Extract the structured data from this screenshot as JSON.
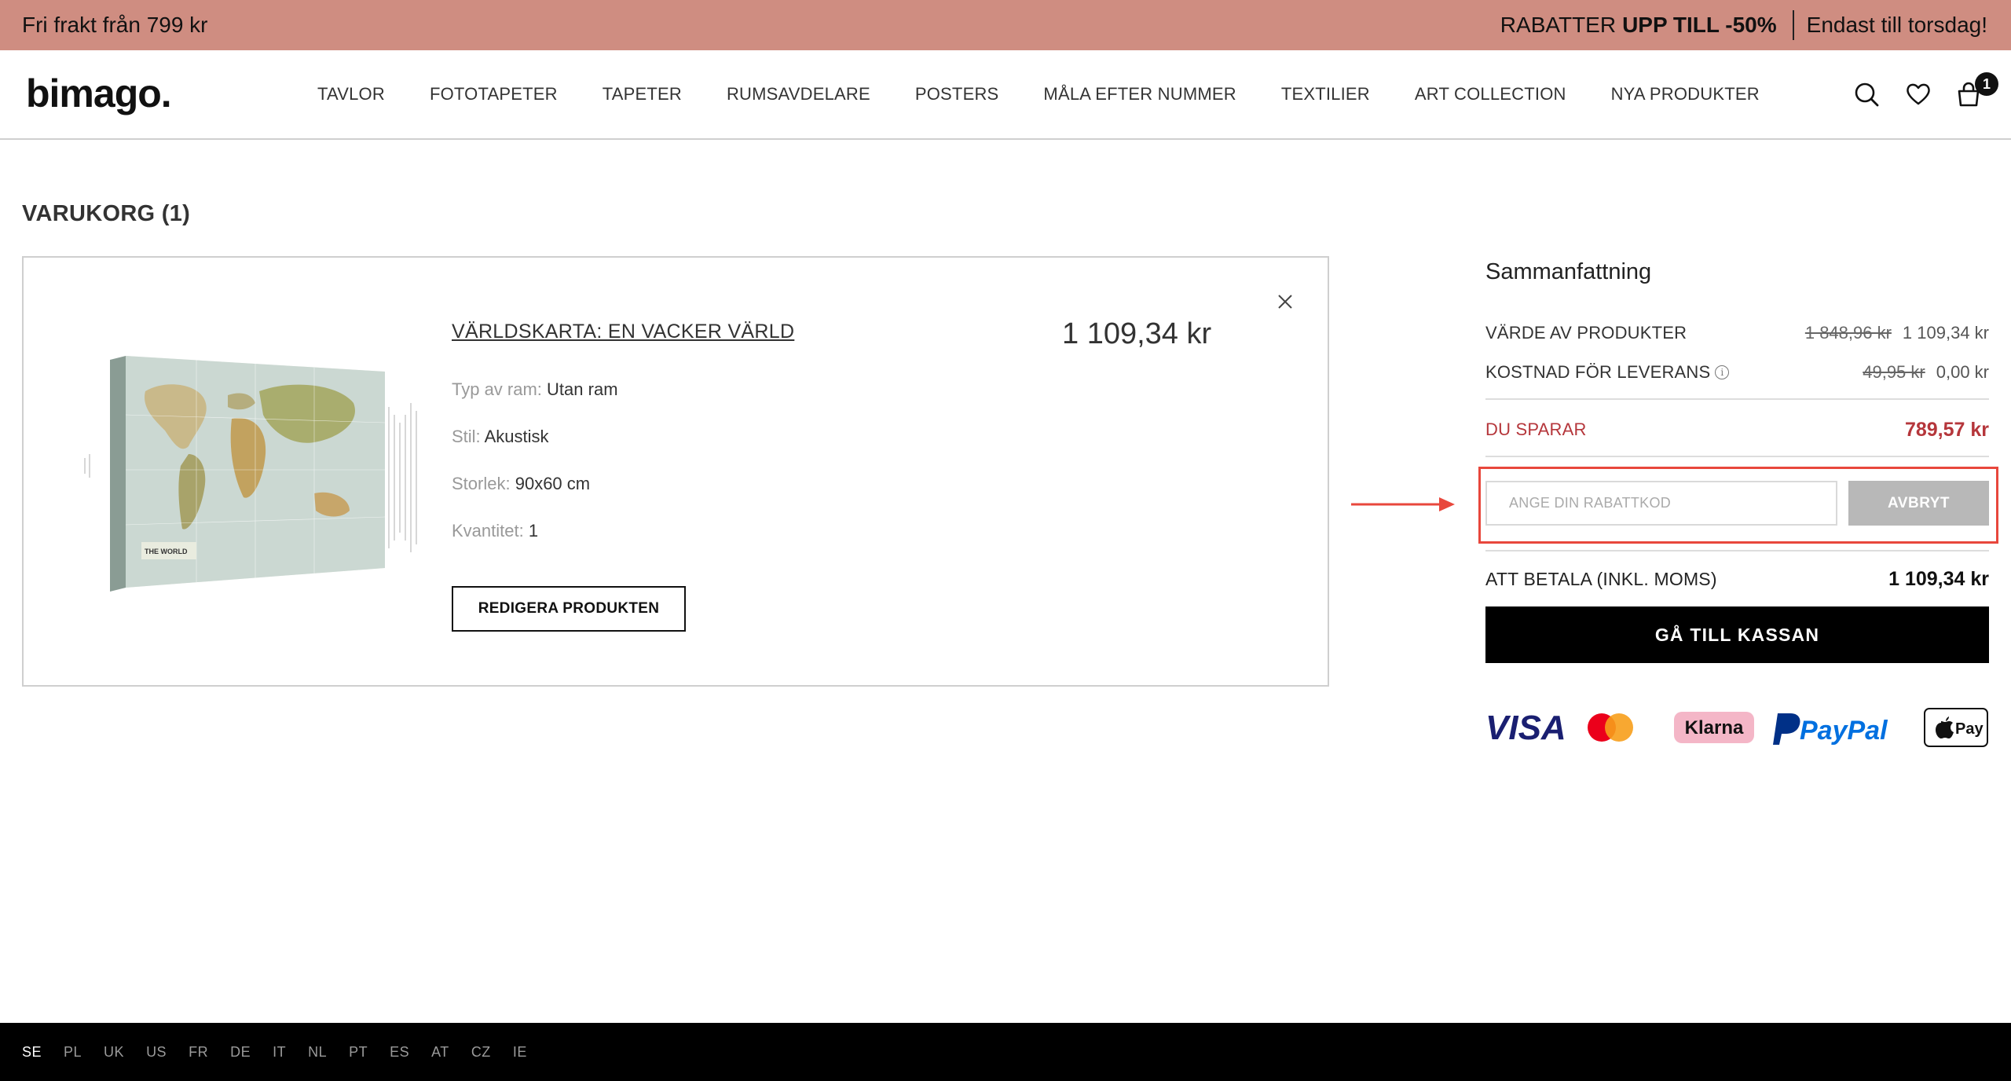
{
  "promo": {
    "left_text": "Fri frakt från 799 kr",
    "discount_prefix": "RABATTER",
    "discount_bold": "UPP TILL -50%",
    "deadline": "Endast till torsdag!"
  },
  "header": {
    "logo": "bimago.",
    "nav": [
      "TAVLOR",
      "FOTOTAPETER",
      "TAPETER",
      "RUMSAVDELARE",
      "POSTERS",
      "MÅLA EFTER NUMMER",
      "TEXTILIER",
      "ART COLLECTION",
      "NYA PRODUKTER"
    ],
    "cart_count": "1"
  },
  "cart": {
    "title": "VARUKORG (1)",
    "item": {
      "name": "VÄRLDSKARTA: EN VACKER VÄRLD",
      "price": "1 109,34 kr",
      "image_caption": "THE WORLD",
      "attributes": [
        {
          "label": "Typ av ram:",
          "value": "Utan ram"
        },
        {
          "label": "Stil:",
          "value": "Akustisk"
        },
        {
          "label": "Storlek:",
          "value": "90x60 cm"
        },
        {
          "label": "Kvantitet:",
          "value": "1"
        }
      ],
      "edit_label": "REDIGERA PRODUKTEN"
    }
  },
  "summary": {
    "title": "Sammanfattning",
    "products_label": "VÄRDE AV PRODUKTER",
    "products_old": "1 848,96 kr",
    "products_new": "1 109,34 kr",
    "delivery_label": "KOSTNAD FÖR LEVERANS",
    "delivery_info": "i",
    "delivery_old": "49,95 kr",
    "delivery_new": "0,00 kr",
    "savings_label": "DU SPARAR",
    "savings_amount": "789,57 kr",
    "code_placeholder": "ANGE DIN RABATTKOD",
    "cancel_label": "AVBRYT",
    "total_label": "ATT BETALA (INKL. MOMS)",
    "total_amount": "1 109,34 kr",
    "checkout_label": "GÅ TILL KASSAN",
    "payment_methods": [
      "VISA",
      "Mastercard",
      "Klarna",
      "PayPal",
      "Apple Pay"
    ],
    "payment_logo_text": {
      "visa": "VISA",
      "klarna": "Klarna",
      "paypal": "PayPal",
      "applepay": "Pay"
    }
  },
  "colors": {
    "promo_bg": "#cf8d81",
    "savings": "#b5363b",
    "highlight": "#e8473c",
    "checkout_bg": "#000000",
    "cancel_bg": "#b8b8b8"
  },
  "footer": {
    "countries": [
      "SE",
      "PL",
      "UK",
      "US",
      "FR",
      "DE",
      "IT",
      "NL",
      "PT",
      "ES",
      "AT",
      "CZ",
      "IE"
    ],
    "active_country": "SE"
  }
}
